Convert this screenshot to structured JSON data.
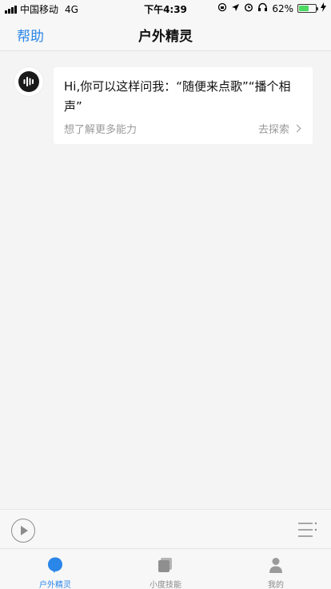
{
  "status_bar": {
    "carrier": "中国移动",
    "network": "4G",
    "time": "下午4:39",
    "battery_text": "62%",
    "battery_level": 0.62,
    "battery_color": "#4cd964"
  },
  "nav": {
    "left_label": "帮助",
    "title": "户外精灵",
    "accent_color": "#2a86e8"
  },
  "chat": {
    "avatar_icon": "voice-wave-icon",
    "greeting": "Hi,你可以这样问我：“随便来点歌”“播个相声”",
    "more_label": "想了解更多能力",
    "explore_label": "去探索"
  },
  "player": {
    "play_icon": "play-icon",
    "playlist_icon": "playlist-icon"
  },
  "tabs": [
    {
      "label": "户外精灵",
      "icon": "bubble-icon",
      "active": true
    },
    {
      "label": "小度技能",
      "icon": "cards-icon",
      "active": false
    },
    {
      "label": "我的",
      "icon": "person-icon",
      "active": false
    }
  ]
}
